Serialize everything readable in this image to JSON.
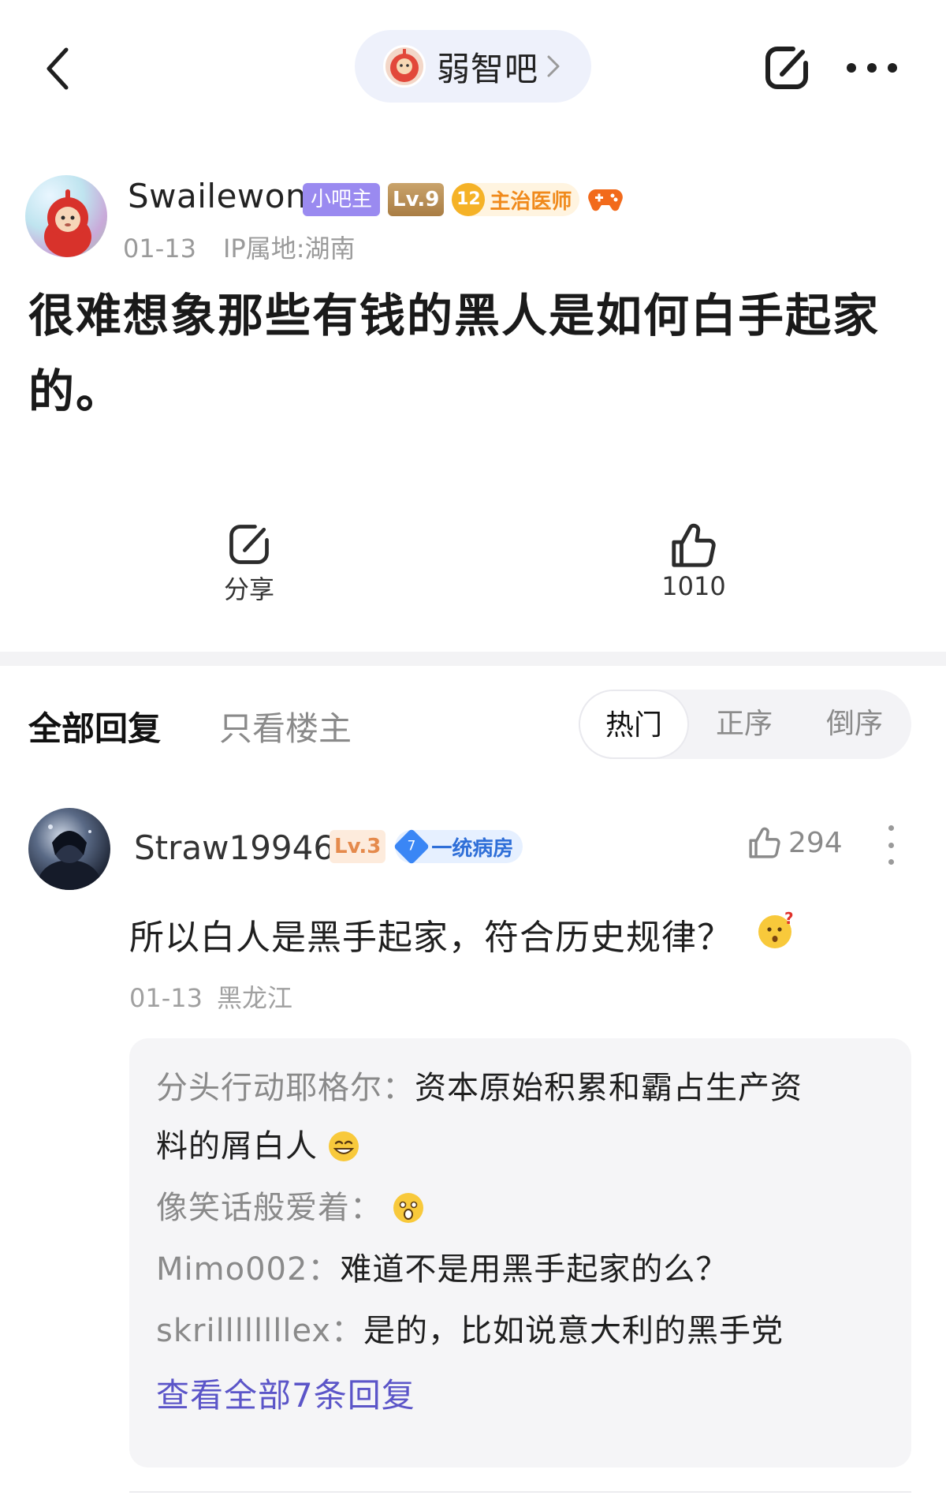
{
  "topbar": {
    "forum_name": "弱智吧"
  },
  "post": {
    "author": {
      "name": "Swailewon",
      "admin_badge": "小吧主",
      "level": "Lv.9",
      "title_level": "12",
      "title": "主治医师",
      "date": "01-13",
      "ip": "IP属地:湖南"
    },
    "content": "很难想象那些有钱的黑人是如何白手起家的。",
    "share_label": "分享",
    "like_count": "1010"
  },
  "reply_tabs": {
    "all": "全部回复",
    "op_only": "只看楼主",
    "sort": [
      "热门",
      "正序",
      "倒序"
    ]
  },
  "comment": {
    "name": "Straw19946",
    "level": "Lv.3",
    "title_level": "7",
    "title": "一统病房",
    "likes": "294",
    "text": "所以白人是黑手起家，符合历史规律？",
    "date": "01-13",
    "location": "黑龙江",
    "replies": [
      {
        "who": "分头行动耶格尔：",
        "text": "资本原始积累和霸占生产资",
        "cont": "料的屑白人"
      },
      {
        "who": "像笑话般爱着：",
        "text": ""
      },
      {
        "who": "Mimo002：",
        "text": "难道不是用黑手起家的么？"
      },
      {
        "who": "skrillllllllex：",
        "text": "是的，比如说意大利的黑手党"
      }
    ],
    "view_all": "查看全部7条回复"
  },
  "colors": {
    "accent_link": "#5b55c8",
    "admin_badge": "#9a8af0",
    "pill_bg": "#eef1fb"
  },
  "icons": [
    "back-arrow-icon",
    "chevron-right-icon",
    "share-icon",
    "more-horizontal-icon",
    "thumbs-up-icon",
    "more-vertical-icon",
    "game-controller-icon",
    "thinking-emoji-icon",
    "grin-emoji-icon",
    "shocked-emoji-icon"
  ]
}
